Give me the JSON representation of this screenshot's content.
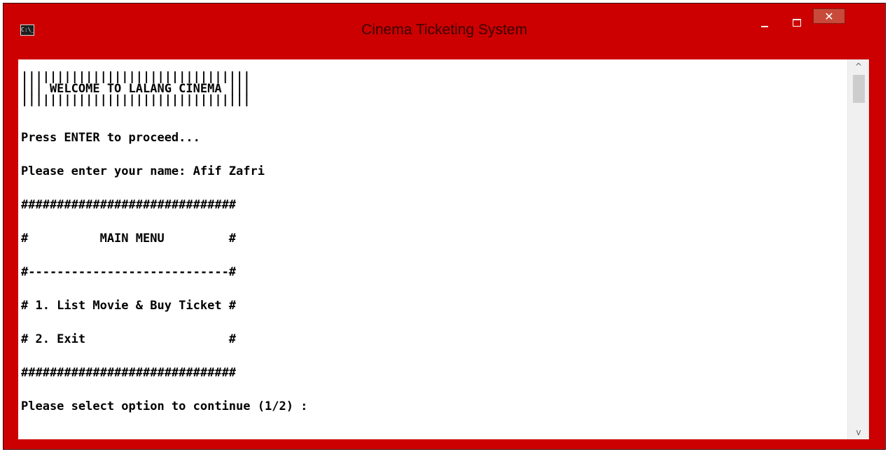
{
  "window": {
    "title": "Cinema Ticketing System",
    "icon_text": "C:\\_",
    "close_glyph": "✕"
  },
  "console": {
    "lines": [
      "||||||||||||||||||||||||||||||||",
      "||| WELCOME TO LALANG CINEMA |||",
      "||||||||||||||||||||||||||||||||",
      "Press ENTER to proceed...",
      "Please enter your name: Afif Zafri",
      "##############################",
      "#          MAIN MENU         #",
      "#----------------------------#",
      "# 1. List Movie & Buy Ticket #",
      "# 2. Exit                    #",
      "##############################",
      "Please select option to continue (1/2) :"
    ]
  },
  "scrollbar": {
    "up_glyph": "^",
    "down_glyph": "v"
  },
  "colors": {
    "title_bar": "#cc0000",
    "close_button": "#c74a3b",
    "console_background": "#ffffff",
    "console_text": "#000000"
  }
}
